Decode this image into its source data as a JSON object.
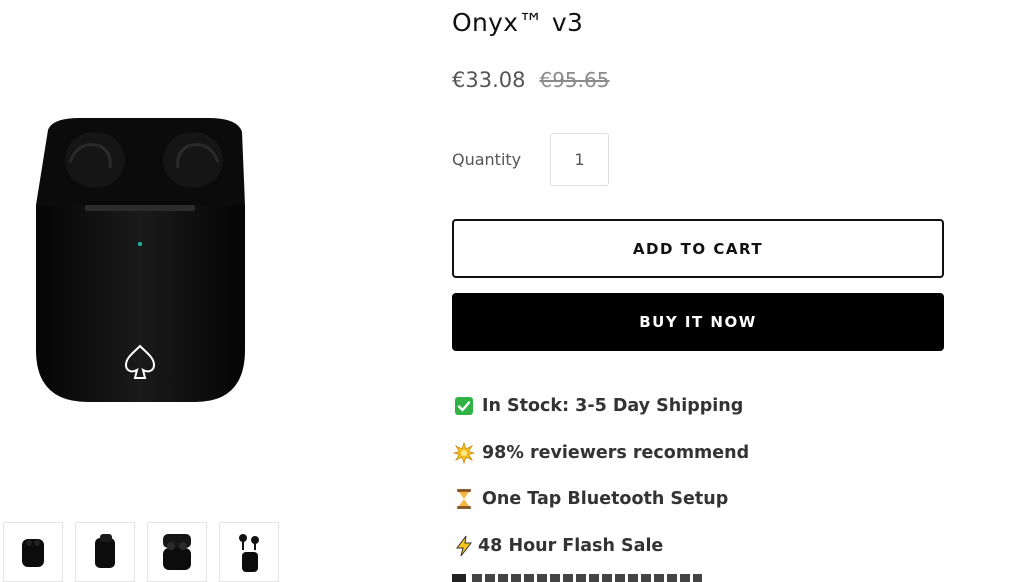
{
  "product": {
    "title": "Onyx™ v3",
    "price": "€33.08",
    "compare_price": "€95.65"
  },
  "quantity": {
    "label": "Quantity",
    "value": "1"
  },
  "buttons": {
    "add_to_cart": "ADD TO CART",
    "buy_now": "BUY IT NOW"
  },
  "features": [
    {
      "icon": "check-mark-icon",
      "text": "In Stock: 3-5 Day Shipping"
    },
    {
      "icon": "sparkle-star-icon",
      "text": "98% reviewers recommend"
    },
    {
      "icon": "hourglass-icon",
      "text": "One Tap Bluetooth Setup"
    },
    {
      "icon": "lightning-bolt-icon",
      "text": "48 Hour Flash Sale"
    }
  ],
  "gallery": {
    "thumbnails": [
      "case-front",
      "case-side",
      "case-open",
      "earbuds-out"
    ]
  },
  "colors": {
    "button_dark": "#000000",
    "check_green": "#2fb344",
    "text": "#333333"
  }
}
